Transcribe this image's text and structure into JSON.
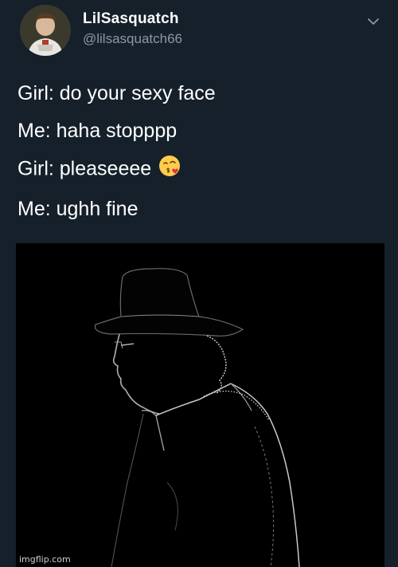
{
  "user": {
    "display_name": "LilSasquatch",
    "handle": "@lilsasquatch66"
  },
  "icons": {
    "more": "chevron-down-icon",
    "emoji": "face-blowing-a-kiss-emoji"
  },
  "tweet": {
    "lines": [
      "Girl: do your sexy face",
      "Me: haha stopppp",
      "Girl: pleaseeee",
      "Me: ughh fine"
    ]
  },
  "watermark": "imgflip.com",
  "colors": {
    "background": "#15202b",
    "handle": "#8899a6",
    "text": "#ffffff"
  }
}
